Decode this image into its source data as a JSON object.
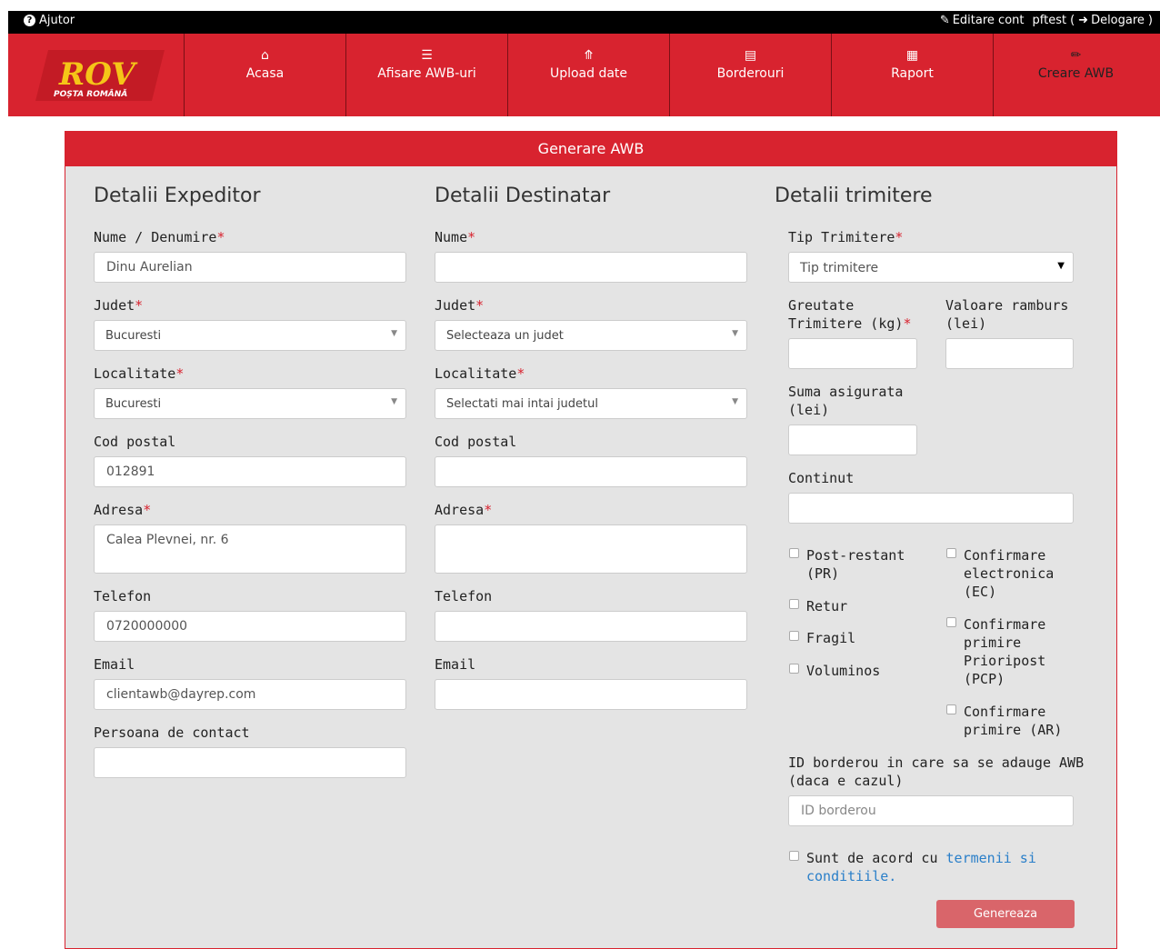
{
  "topbar": {
    "help": "Ajutor",
    "edit_account": "Editare cont",
    "user": "pftest",
    "paren_open": "(",
    "logout": "Delogare",
    "paren_close": ")"
  },
  "logo": {
    "mark": "ROV",
    "text": "POȘTA ROMÂNĂ"
  },
  "nav": [
    {
      "label": "Acasa",
      "icon": "home-icon"
    },
    {
      "label": "Afisare AWB-uri",
      "icon": "list-icon"
    },
    {
      "label": "Upload date",
      "icon": "upload-icon"
    },
    {
      "label": "Borderouri",
      "icon": "newspaper-icon"
    },
    {
      "label": "Raport",
      "icon": "report-icon"
    },
    {
      "label": "Creare AWB",
      "icon": "pencil-icon"
    }
  ],
  "panel_title": "Generare AWB",
  "sender": {
    "title": "Detalii Expeditor",
    "name_label": "Nume / Denumire",
    "name_value": "Dinu Aurelian",
    "county_label": "Judet",
    "county_value": "Bucuresti",
    "locality_label": "Localitate",
    "locality_value": "Bucuresti",
    "postal_label": "Cod postal",
    "postal_value": "012891",
    "address_label": "Adresa",
    "address_value": "Calea Plevnei, nr. 6",
    "phone_label": "Telefon",
    "phone_value": "0720000000",
    "email_label": "Email",
    "email_value": "clientawb@dayrep.com",
    "contact_label": "Persoana de contact",
    "contact_value": ""
  },
  "recipient": {
    "title": "Detalii Destinatar",
    "name_label": "Nume",
    "county_label": "Judet",
    "county_value": "Selecteaza un judet",
    "locality_label": "Localitate",
    "locality_value": "Selectati mai intai judetul",
    "postal_label": "Cod postal",
    "address_label": "Adresa",
    "phone_label": "Telefon",
    "email_label": "Email"
  },
  "shipment": {
    "title": "Detalii trimitere",
    "type_label": "Tip Trimitere",
    "type_value": "Tip trimitere",
    "weight_label_1": "Greutate",
    "weight_label_2": "Trimitere (kg)",
    "cod_label_1": "Valoare ramburs",
    "cod_label_2": "(lei)",
    "insured_label_1": "Suma asigurata",
    "insured_label_2": "(lei)",
    "content_label": "Continut",
    "options_left": [
      {
        "lines": [
          "Post-restant",
          "(PR)"
        ]
      },
      {
        "lines": [
          "Retur"
        ]
      },
      {
        "lines": [
          "Fragil"
        ]
      },
      {
        "lines": [
          "Voluminos"
        ]
      }
    ],
    "options_right": [
      {
        "lines": [
          "Confirmare",
          "electronica",
          "(EC)"
        ]
      },
      {
        "lines": [
          "Confirmare",
          "primire",
          "Prioripost",
          "(PCP)"
        ]
      },
      {
        "lines": [
          "Confirmare",
          "primire (AR)"
        ]
      }
    ],
    "border_label_1": "ID borderou in care sa se adauge AWB",
    "border_label_2": "(daca e cazul)",
    "border_placeholder": "ID borderou",
    "terms_prefix": "Sunt de acord cu",
    "terms_link_1": "termenii si",
    "terms_link_2": "conditiile.",
    "submit": "Genereaza"
  },
  "required_mark": "*",
  "colors": {
    "brand_red": "#d8232f",
    "panel_bg": "#e4e4e4",
    "link_blue": "#2a7fc9",
    "button_bg": "#d9656a"
  }
}
